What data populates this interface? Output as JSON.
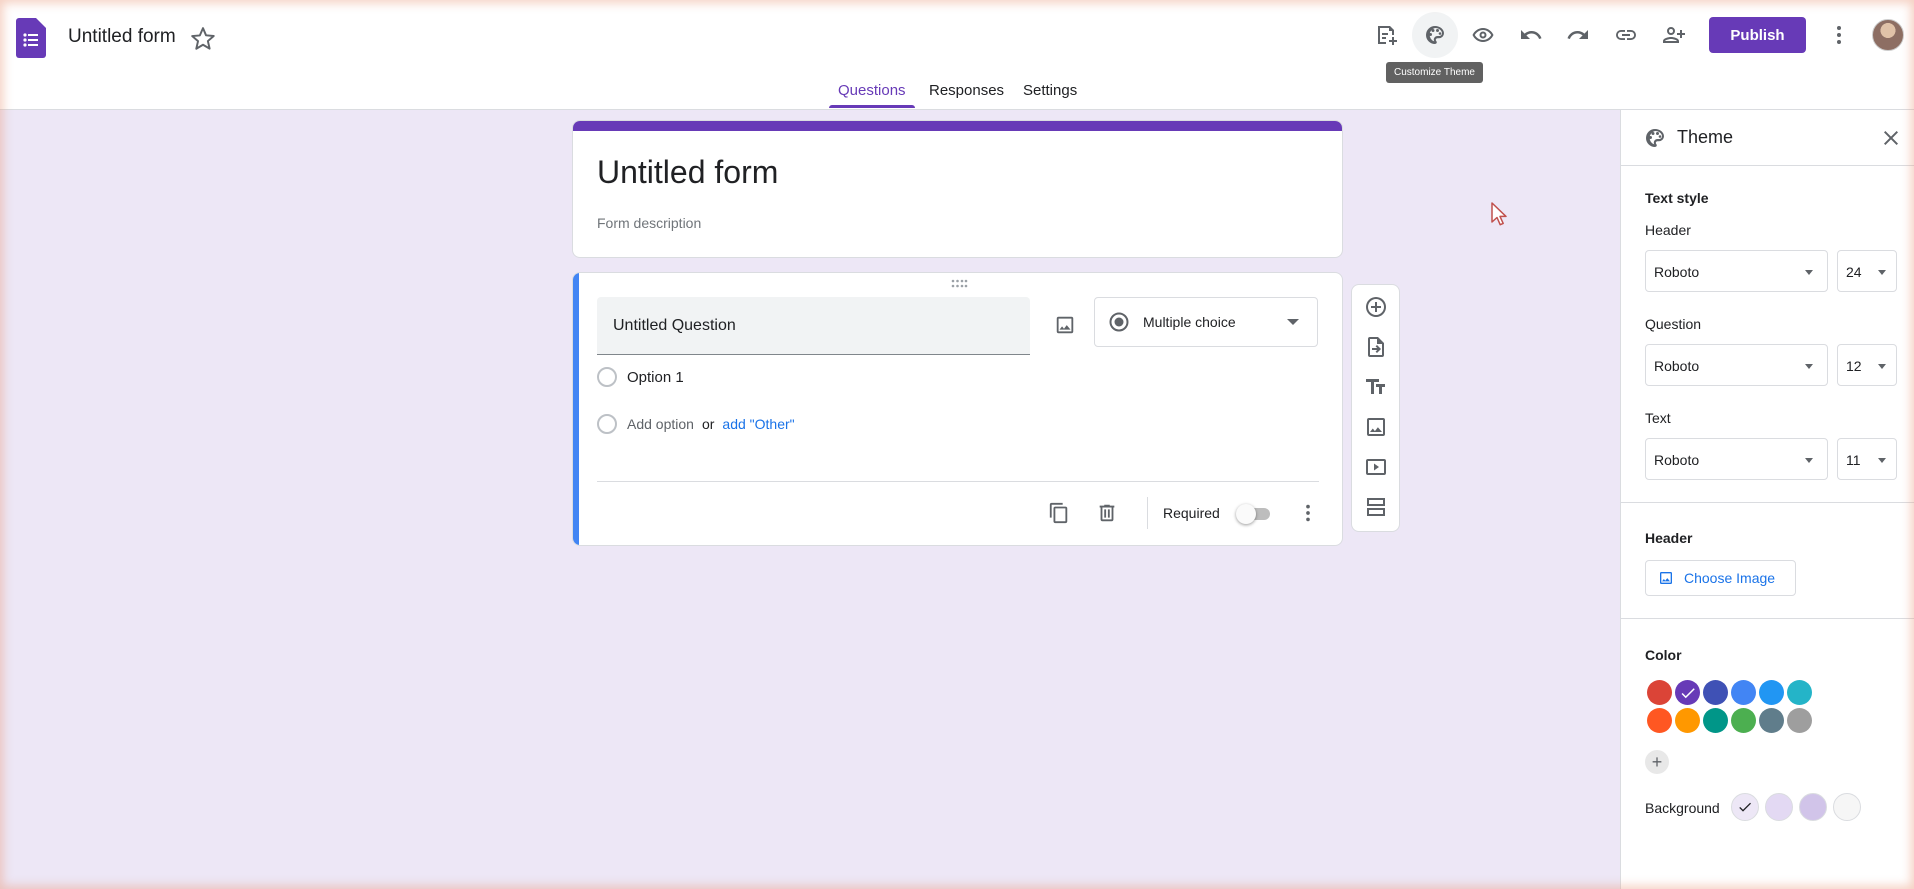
{
  "header": {
    "doc_title": "Untitled form",
    "publish_label": "Publish",
    "tooltip": "Customize Theme",
    "icons": [
      "add-on-icon",
      "palette-icon",
      "preview-icon",
      "undo-icon",
      "redo-icon",
      "link-icon",
      "add-collaborator-icon",
      "more-vert-icon"
    ]
  },
  "tabs": [
    {
      "label": "Questions",
      "active": true
    },
    {
      "label": "Responses",
      "active": false
    },
    {
      "label": "Settings",
      "active": false
    }
  ],
  "form": {
    "title": "Untitled form",
    "description": "Form description"
  },
  "question": {
    "title": "Untitled Question",
    "type": "Multiple choice",
    "options": [
      "Option 1"
    ],
    "add_option": "Add option",
    "or": "or",
    "add_other": "add \"Other\"",
    "required_label": "Required",
    "required": false
  },
  "theme_panel": {
    "title": "Theme",
    "text_style": {
      "section_title": "Text style",
      "header_label": "Header",
      "header_font": "Roboto",
      "header_size": "24",
      "question_label": "Question",
      "question_font": "Roboto",
      "question_size": "12",
      "text_label": "Text",
      "text_font": "Roboto",
      "text_size": "11"
    },
    "header": {
      "section_title": "Header",
      "choose_image": "Choose Image"
    },
    "color": {
      "section_title": "Color",
      "swatches": [
        "#db4437",
        "#673ab7",
        "#3f51b5",
        "#4285f4",
        "#2196f3",
        "#24b4c8",
        "#ff5722",
        "#ff9800",
        "#009688",
        "#4caf50",
        "#607d8b",
        "#9e9e9e"
      ],
      "selected_index": 1
    },
    "background": {
      "label": "Background",
      "swatches": [
        "#ede7f6",
        "#e3d9f3",
        "#d1c4e9",
        "#f6f6f6"
      ],
      "selected_index": 0
    }
  },
  "colors": {
    "accent": "#673ab7",
    "page_bg": "#ede7f6",
    "question_bar": "#4285f4",
    "link": "#1a73e8"
  }
}
